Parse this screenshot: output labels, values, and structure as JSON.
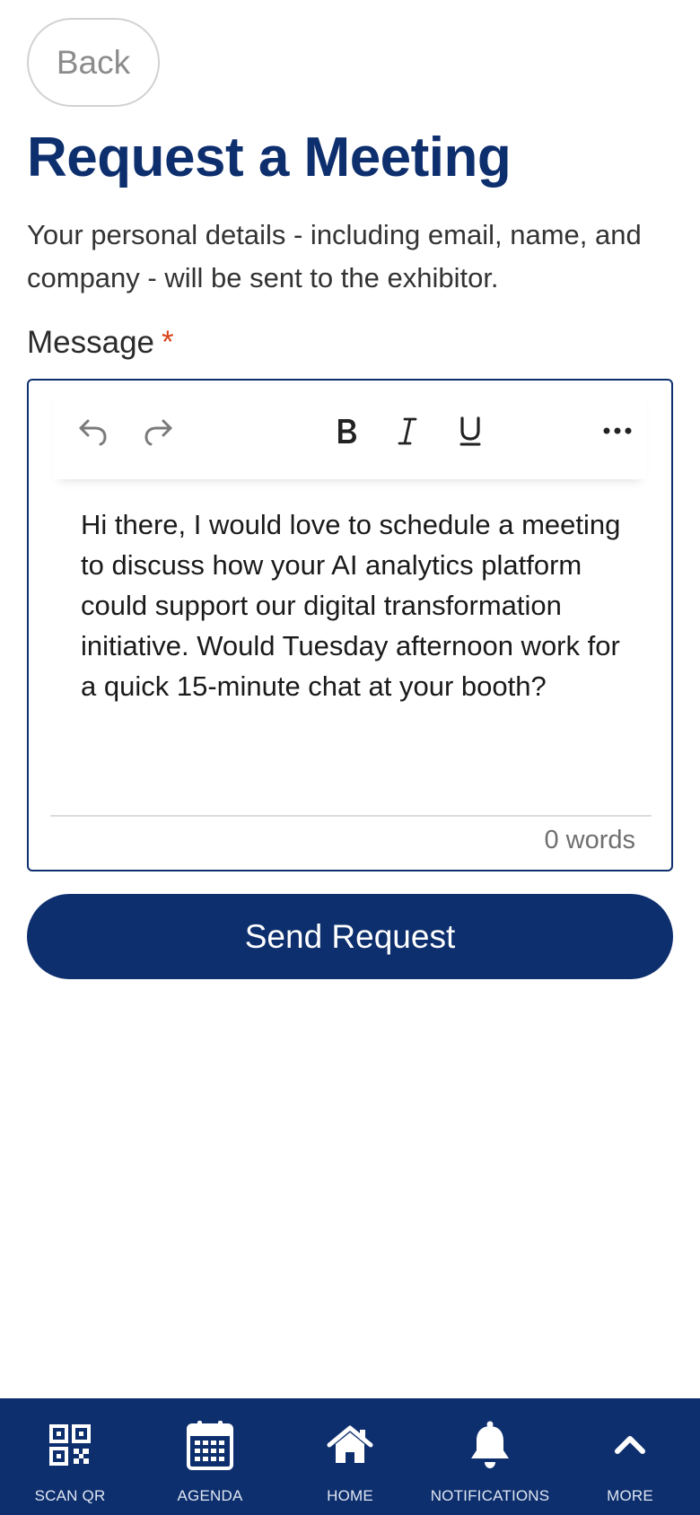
{
  "back": {
    "label": "Back"
  },
  "page": {
    "title": "Request a Meeting",
    "intro": "Your personal details - including email, name, and company - will be sent to the exhibitor."
  },
  "message": {
    "label": "Message",
    "required_mark": "*",
    "body": "Hi there, I would love to schedule a meeting to discuss how your AI analytics platform could support our digital transformation initiative. Would Tuesday afternoon work for a quick 15-minute chat at your booth?",
    "word_count": "0 words"
  },
  "toolbar": {
    "items": [
      {
        "icon": "undo-icon"
      },
      {
        "icon": "redo-icon"
      },
      {
        "icon": "bold-icon"
      },
      {
        "icon": "italic-icon"
      },
      {
        "icon": "underline-icon"
      },
      {
        "icon": "more-horizontal-icon"
      }
    ]
  },
  "send": {
    "label": "Send Request"
  },
  "nav": {
    "items": [
      {
        "label": "SCAN QR",
        "icon": "qr-code-icon"
      },
      {
        "label": "AGENDA",
        "icon": "calendar-icon"
      },
      {
        "label": "HOME",
        "icon": "home-icon"
      },
      {
        "label": "NOTIFICATIONS",
        "icon": "bell-icon"
      },
      {
        "label": "MORE",
        "icon": "chevron-up-icon"
      }
    ]
  },
  "colors": {
    "brand": "#0e2f6e",
    "required": "#d9461a",
    "nav_text": "#dfe6f2"
  }
}
